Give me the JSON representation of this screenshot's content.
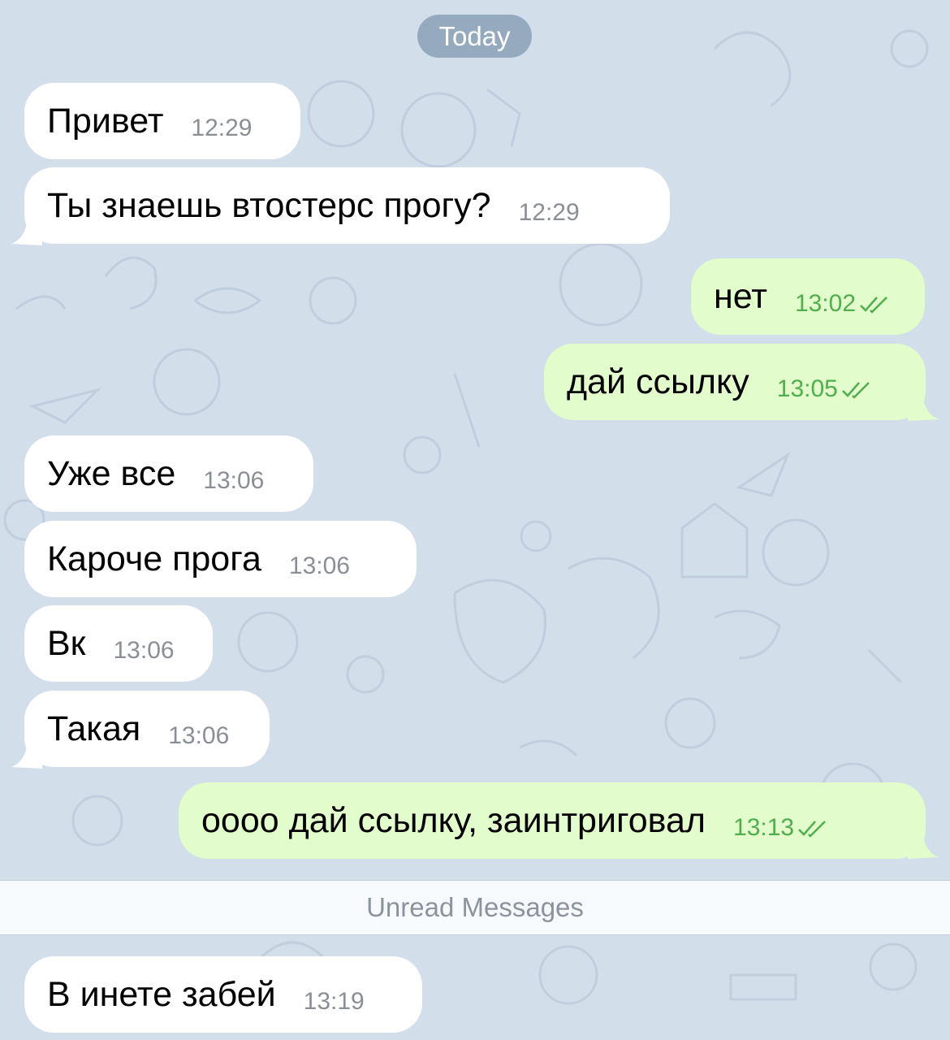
{
  "chat": {
    "date_label": "Today",
    "unread_label": "Unread Messages",
    "colors": {
      "background": "#d3deeb",
      "incoming_bubble": "#ffffff",
      "outgoing_bubble": "#e2fdcb",
      "outgoing_time": "#4fae4e",
      "read_checks": "#4fae4e"
    },
    "messages": [
      {
        "direction": "incoming",
        "text": "Привет",
        "time": "12:29"
      },
      {
        "direction": "incoming",
        "text": "Ты знаешь втостерс прогу?",
        "time": "12:29"
      },
      {
        "direction": "outgoing",
        "text": "нет",
        "time": "13:02",
        "status": "read"
      },
      {
        "direction": "outgoing",
        "text": "дай ссылку",
        "time": "13:05",
        "status": "read"
      },
      {
        "direction": "incoming",
        "text": "Уже все",
        "time": "13:06"
      },
      {
        "direction": "incoming",
        "text": "Кароче прога",
        "time": "13:06"
      },
      {
        "direction": "incoming",
        "text": "Вк",
        "time": "13:06"
      },
      {
        "direction": "incoming",
        "text": "Такая",
        "time": "13:06"
      },
      {
        "direction": "outgoing",
        "text": "оооо дай ссылку, заинтриговал",
        "time": "13:13",
        "status": "read"
      },
      {
        "direction": "incoming",
        "text": "В инете забей",
        "time": "13:19"
      }
    ]
  }
}
